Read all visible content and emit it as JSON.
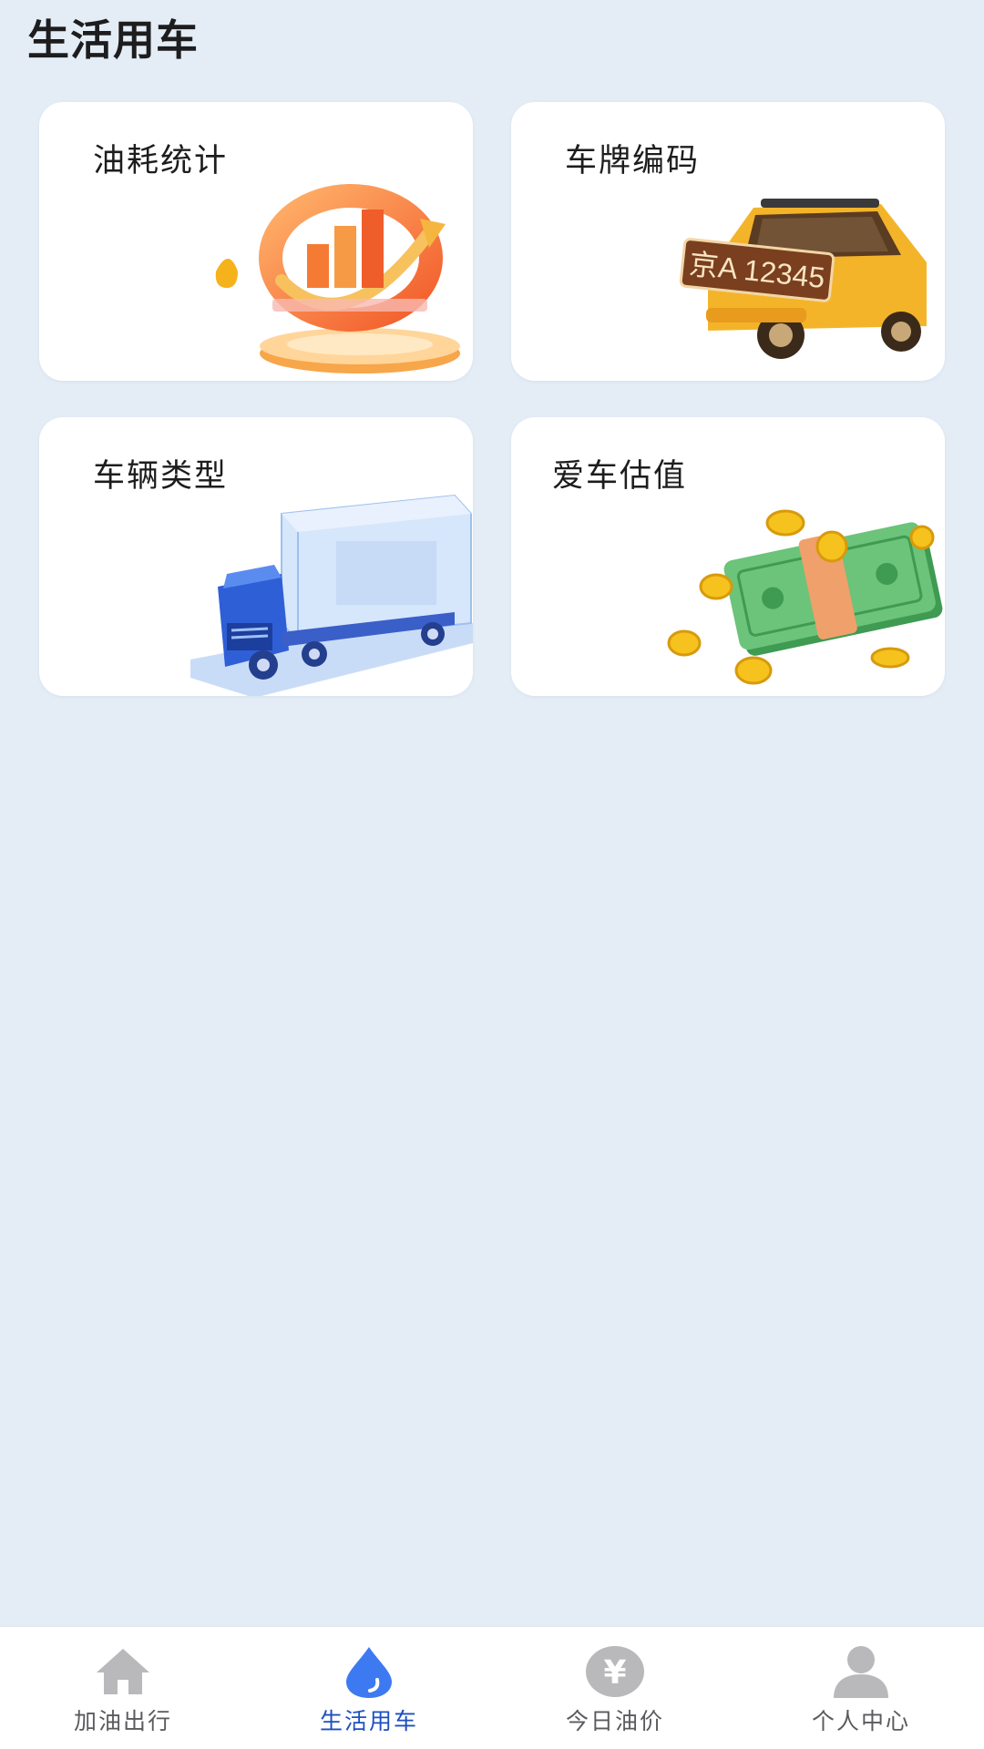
{
  "header": {
    "title": "生活用车"
  },
  "cards": [
    {
      "title": "油耗统计",
      "icon": "fuel-stats-chart"
    },
    {
      "title": "车牌编码",
      "icon": "yellow-car-with-plate",
      "plate_text": "京A 12345"
    },
    {
      "title": "车辆类型",
      "icon": "blue-truck"
    },
    {
      "title": "爱车估值",
      "icon": "cash-and-coins"
    }
  ],
  "tabbar": {
    "items": [
      {
        "label": "加油出行",
        "icon": "home-icon",
        "active": false
      },
      {
        "label": "生活用车",
        "icon": "drop-icon",
        "active": true
      },
      {
        "label": "今日油价",
        "icon": "yen-icon",
        "active": false
      },
      {
        "label": "个人中心",
        "icon": "user-icon",
        "active": false
      }
    ],
    "active_color": "#1d4fc0",
    "inactive_color": "#b9b9bb"
  }
}
